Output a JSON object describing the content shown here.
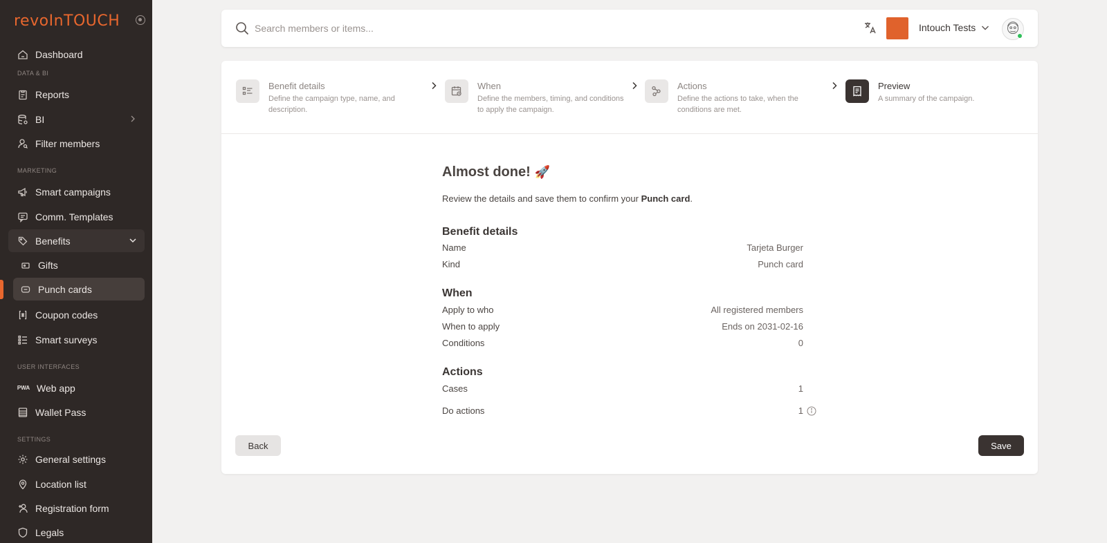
{
  "app": {
    "logo_bold": "revo",
    "logo_thin": "InTOUCH"
  },
  "sidebar": {
    "sections": {
      "data_bi": "DATA & BI",
      "marketing": "MARKETING",
      "user_interfaces": "USER INTERFACES",
      "settings": "SETTINGS"
    },
    "items": {
      "dashboard": "Dashboard",
      "reports": "Reports",
      "bi": "BI",
      "filter_members": "Filter members",
      "smart_campaigns": "Smart campaigns",
      "comm_templates": "Comm. Templates",
      "benefits": "Benefits",
      "gifts": "Gifts",
      "punch_cards": "Punch cards",
      "coupon_codes": "Coupon codes",
      "smart_surveys": "Smart surveys",
      "web_app": "Web app",
      "web_app_badge": "PWA",
      "wallet_pass": "Wallet Pass",
      "general_settings": "General settings",
      "location_list": "Location list",
      "registration_form": "Registration form",
      "legals": "Legals"
    },
    "active_item": "Punch cards"
  },
  "topbar": {
    "search_placeholder": "Search members or items...",
    "org_name": "Intouch Tests",
    "org_color": "#e0622c"
  },
  "stepper": {
    "steps": [
      {
        "title": "Benefit details",
        "desc": "Define the campaign type, name, and description.",
        "icon": "list-icon"
      },
      {
        "title": "When",
        "desc": "Define the members, timing, and conditions to apply the campaign.",
        "icon": "calendar-icon"
      },
      {
        "title": "Actions",
        "desc": "Define the actions to take, when the conditions are met.",
        "icon": "actions-icon"
      },
      {
        "title": "Preview",
        "desc": "A summary of the campaign.",
        "icon": "receipt-icon"
      }
    ],
    "current_step": 3
  },
  "preview": {
    "heading": "Almost done!",
    "heading_emoji": "🚀",
    "intro_before": "Review the details and save them to confirm your ",
    "intro_bold": "Punch card",
    "intro_after": ".",
    "sections": {
      "benefit_details": {
        "title": "Benefit details",
        "rows": [
          {
            "label": "Name",
            "value": "Tarjeta Burger"
          },
          {
            "label": "Kind",
            "value": "Punch card"
          }
        ]
      },
      "when": {
        "title": "When",
        "rows": [
          {
            "label": "Apply to who",
            "value": "All registered members"
          },
          {
            "label": "When to apply",
            "value": "Ends on 2031-02-16"
          },
          {
            "label": "Conditions",
            "value": "0"
          }
        ]
      },
      "actions": {
        "title": "Actions",
        "rows": [
          {
            "label": "Cases",
            "value": "1"
          },
          {
            "label": "Do actions",
            "value": "1"
          }
        ]
      }
    }
  },
  "buttons": {
    "back": "Back",
    "save": "Save"
  },
  "colors": {
    "accent": "#e8672e",
    "sidebar_bg": "#2e2826",
    "primary_button": "#3a3331"
  }
}
